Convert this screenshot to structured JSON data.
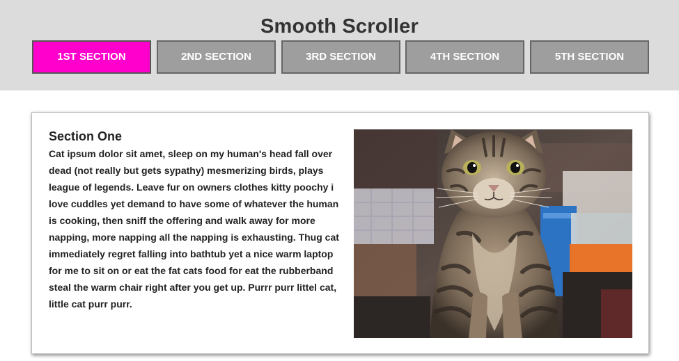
{
  "header": {
    "title": "Smooth Scroller"
  },
  "nav": {
    "items": [
      {
        "label": "1ST SECTION",
        "active": true
      },
      {
        "label": "2ND SECTION",
        "active": false
      },
      {
        "label": "3RD SECTION",
        "active": false
      },
      {
        "label": "4TH SECTION",
        "active": false
      },
      {
        "label": "5TH SECTION",
        "active": false
      }
    ]
  },
  "section": {
    "heading": "Section One",
    "body": "Cat ipsum dolor sit amet, sleep on my human's head fall over dead (not really but gets sypathy) mesmerizing birds, plays league of legends. Leave fur on owners clothes kitty poochy i love cuddles yet demand to have some of whatever the human is cooking, then sniff the offering and walk away for more napping, more napping all the napping is exhausting. Thug cat immediately regret falling into bathtub yet a nice warm laptop for me to sit on or eat the fat cats food for eat the rubberband steal the warm chair right after you get up. Purrr purr littel cat, little cat purr purr."
  },
  "colors": {
    "header_bg": "#dcdcdc",
    "active_button": "#ff00cc",
    "inactive_button": "#9e9e9e"
  }
}
